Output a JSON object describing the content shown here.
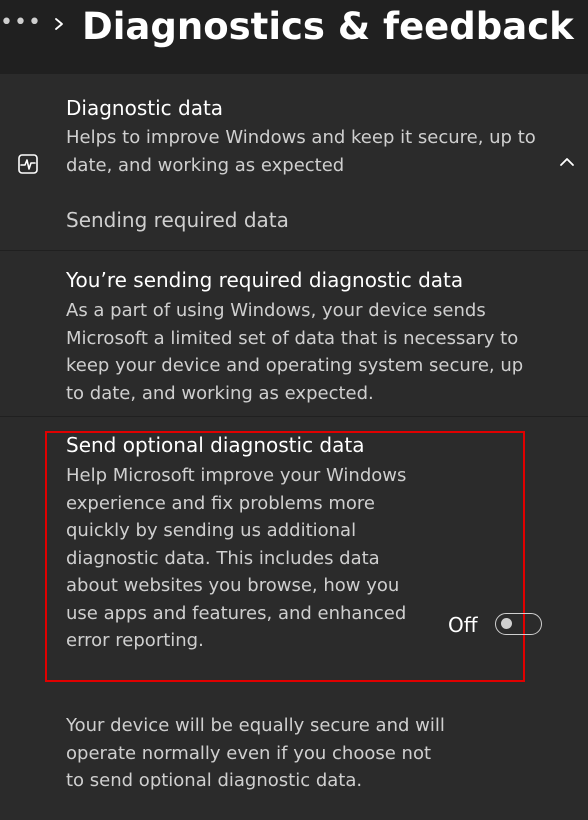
{
  "header": {
    "more_label": "•••",
    "title": "Diagnostics & feedback"
  },
  "diagnostic_data": {
    "title": "Diagnostic data",
    "description": "Helps to improve Windows and keep it secure, up to date, and working as expected",
    "status": "Sending required data",
    "icon": "pulse-icon"
  },
  "required_data": {
    "title": "You’re sending required diagnostic data",
    "description": "As a part of using Windows, your device sends Microsoft a limited set of data that is necessary to keep your device and operating system secure, up to date, and working as expected."
  },
  "optional_data": {
    "title": "Send optional diagnostic data",
    "description": "Help Microsoft improve your Windows experience and fix problems more quickly by sending us additional diagnostic data. This includes data about websites you browse, how you use apps and features, and enhanced error reporting.",
    "toggle_label": "Off",
    "toggle_state": false,
    "highlight_color": "#e00000"
  },
  "footnote": "Your device will be equally secure and will operate normally even if you choose not to send optional diagnostic data."
}
